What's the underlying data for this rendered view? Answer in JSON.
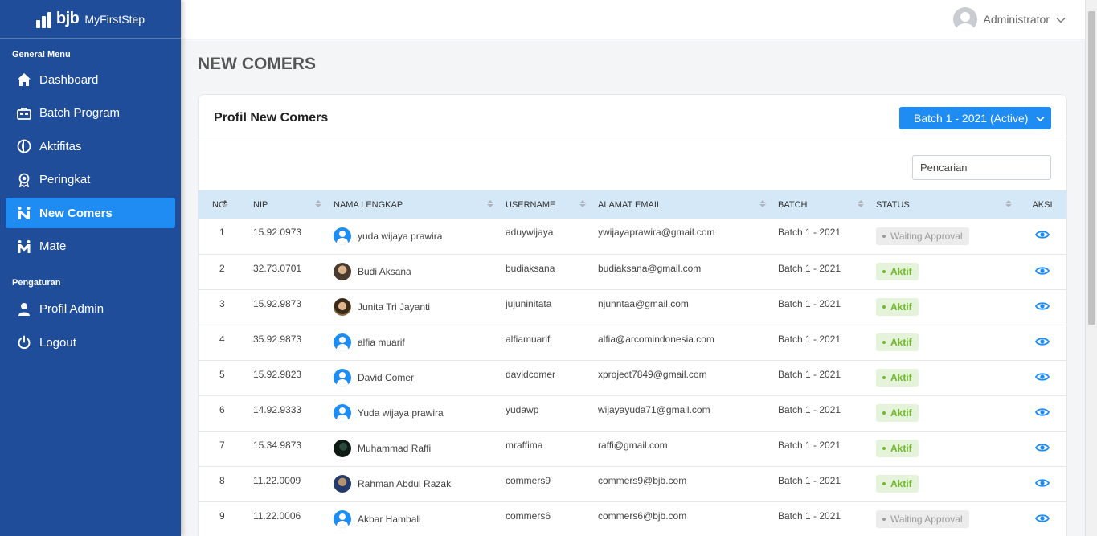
{
  "sidebar": {
    "logo_bjb": "bjb",
    "logo_sub": "MyFirstStep",
    "general_title": "General Menu",
    "general_items": [
      {
        "label": "Dashboard",
        "icon": "home-icon"
      },
      {
        "label": "Batch Program",
        "icon": "briefcase-icon"
      },
      {
        "label": "Aktifitas",
        "icon": "globe-icon"
      },
      {
        "label": "Peringkat",
        "icon": "award-icon"
      },
      {
        "label": "New Comers",
        "icon": "newcomers-icon",
        "active": true
      },
      {
        "label": "Mate",
        "icon": "mate-icon"
      }
    ],
    "settings_title": "Pengaturan",
    "settings_items": [
      {
        "label": "Profil Admin",
        "icon": "user-icon"
      },
      {
        "label": "Logout",
        "icon": "power-icon"
      }
    ]
  },
  "topbar": {
    "user_name": "Administrator"
  },
  "page": {
    "title": "NEW COMERS"
  },
  "card": {
    "title": "Profil New Comers",
    "batch_selected": "Batch 1 - 2021 (Active)",
    "search_placeholder": "Pencarian"
  },
  "table": {
    "headers": {
      "no": "NO",
      "nip": "NIP",
      "name": "NAMA LENGKAP",
      "username": "USERNAME",
      "email": "ALAMAT EMAIL",
      "batch": "BATCH",
      "status": "STATUS",
      "aksi": "AKSI"
    },
    "rows": [
      {
        "no": "1",
        "nip": "15.92.0973",
        "name": "yuda wijaya prawira",
        "avatar": "default",
        "username": "aduywijaya",
        "email": "ywijayaprawira@gmail.com",
        "batch": "Batch 1 - 2021",
        "status": "Waiting Approval",
        "status_type": "waiting"
      },
      {
        "no": "2",
        "nip": "32.73.0701",
        "name": "Budi Aksana",
        "avatar": "photo1",
        "username": "budiaksana",
        "email": "budiaksana@gmail.com",
        "batch": "Batch 1 - 2021",
        "status": "Aktif",
        "status_type": "aktif"
      },
      {
        "no": "3",
        "nip": "15.92.9873",
        "name": "Junita Tri Jayanti",
        "avatar": "photo2",
        "username": "jujuninitata",
        "email": "njunntaa@gmail.com",
        "batch": "Batch 1 - 2021",
        "status": "Aktif",
        "status_type": "aktif"
      },
      {
        "no": "4",
        "nip": "35.92.9873",
        "name": "alfia muarif",
        "avatar": "default",
        "username": "alfiamuarif",
        "email": "alfia@arcomindonesia.com",
        "batch": "Batch 1 - 2021",
        "status": "Aktif",
        "status_type": "aktif"
      },
      {
        "no": "5",
        "nip": "15.92.9823",
        "name": "David Comer",
        "avatar": "default",
        "username": "davidcomer",
        "email": "xproject7849@gmail.com",
        "batch": "Batch 1 - 2021",
        "status": "Aktif",
        "status_type": "aktif"
      },
      {
        "no": "6",
        "nip": "14.92.9333",
        "name": "Yuda wijaya prawira",
        "avatar": "default",
        "username": "yudawp",
        "email": "wijayayuda71@gmail.com",
        "batch": "Batch 1 - 2021",
        "status": "Aktif",
        "status_type": "aktif"
      },
      {
        "no": "7",
        "nip": "15.34.9873",
        "name": "Muhammad Raffi",
        "avatar": "photo3",
        "username": "mraffima",
        "email": "raffi@gmail.com",
        "batch": "Batch 1 - 2021",
        "status": "Aktif",
        "status_type": "aktif"
      },
      {
        "no": "8",
        "nip": "11.22.0009",
        "name": "Rahman Abdul Razak",
        "avatar": "photo4",
        "username": "commers9",
        "email": "commers9@bjb.com",
        "batch": "Batch 1 - 2021",
        "status": "Aktif",
        "status_type": "aktif"
      },
      {
        "no": "9",
        "nip": "11.22.0006",
        "name": "Akbar Hambali",
        "avatar": "default",
        "username": "commers6",
        "email": "commers6@bjb.com",
        "batch": "Batch 1 - 2021",
        "status": "Waiting Approval",
        "status_type": "waiting"
      }
    ]
  },
  "colors": {
    "sidebar_bg": "#1f4d9a",
    "accent": "#1e8cf3",
    "table_header_bg": "#d4e8f7",
    "aktif_bg": "#e4f3d9",
    "aktif_text": "#6fba2c",
    "waiting_bg": "#ececec",
    "waiting_text": "#9a9a9a"
  }
}
